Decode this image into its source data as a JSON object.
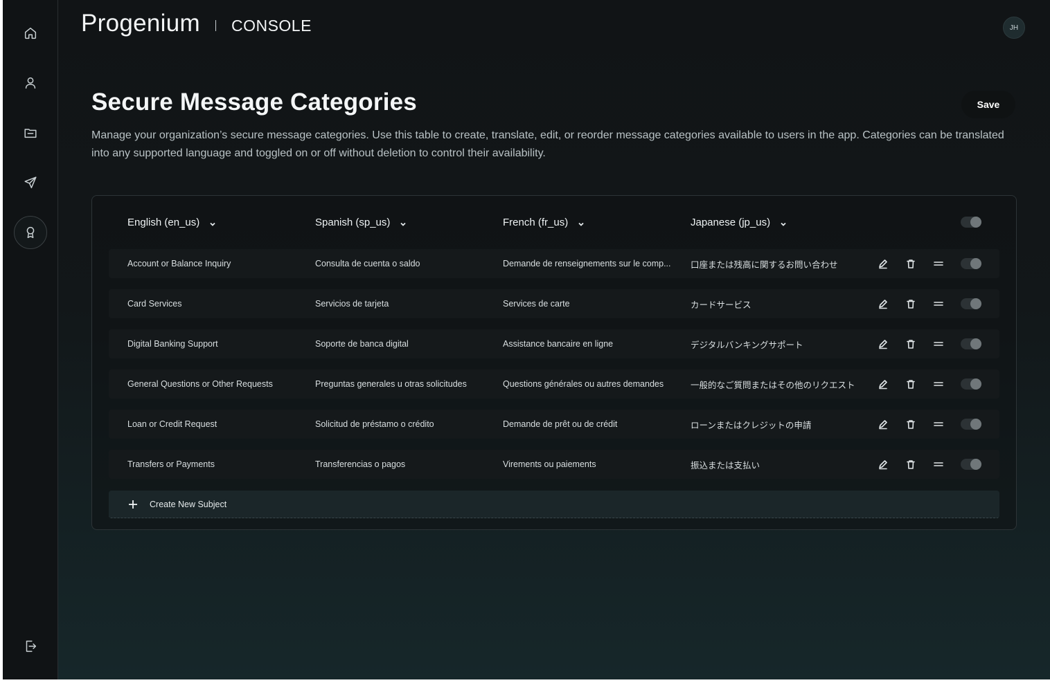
{
  "brand": {
    "name": "Progenium",
    "section": "CONSOLE"
  },
  "user": {
    "initials": "JH"
  },
  "sidebar": {
    "items": [
      {
        "icon": "home-icon"
      },
      {
        "icon": "user-icon"
      },
      {
        "icon": "folder-icon"
      },
      {
        "icon": "send-icon"
      },
      {
        "icon": "award-icon",
        "active": true
      }
    ],
    "logout_icon": "logout-icon"
  },
  "page": {
    "title": "Secure Message Categories",
    "save_label": "Save",
    "description": "Manage your organization’s secure message categories. Use this table to create, translate, edit, or reorder message categories available to users in the app. Categories can be translated into any supported language and toggled on or off without deletion to control their availability."
  },
  "table": {
    "columns": [
      "English (en_us)",
      "Spanish (sp_us)",
      "French (fr_us)",
      "Japanese (jp_us)"
    ],
    "rows": [
      {
        "en": "Account or Balance Inquiry",
        "es": "Consulta de cuenta o saldo",
        "fr": "Demande de renseignements sur le comp...",
        "jp": "口座または残高に関するお問い合わせ"
      },
      {
        "en": "Card Services",
        "es": "Servicios de tarjeta",
        "fr": "Services de carte",
        "jp": "カードサービス"
      },
      {
        "en": "Digital Banking Support",
        "es": "Soporte de banca digital",
        "fr": "Assistance bancaire en ligne",
        "jp": "デジタルバンキングサポート"
      },
      {
        "en": "General Questions or Other Requests",
        "es": "Preguntas generales u otras solicitudes",
        "fr": "Questions générales ou autres demandes",
        "jp": "一般的なご質問またはその他のリクエスト"
      },
      {
        "en": "Loan or Credit Request",
        "es": "Solicitud de préstamo o crédito",
        "fr": "Demande de prêt ou de crédit",
        "jp": "ローンまたはクレジットの申請"
      },
      {
        "en": "Transfers or Payments",
        "es": "Transferencias o pagos",
        "fr": "Virements ou paiements",
        "jp": "振込または支払い"
      }
    ],
    "create_label": "Create New Subject"
  },
  "colors": {
    "background": "#121719",
    "card_row": "#15191b",
    "accent_text": "#f4f6f7"
  }
}
